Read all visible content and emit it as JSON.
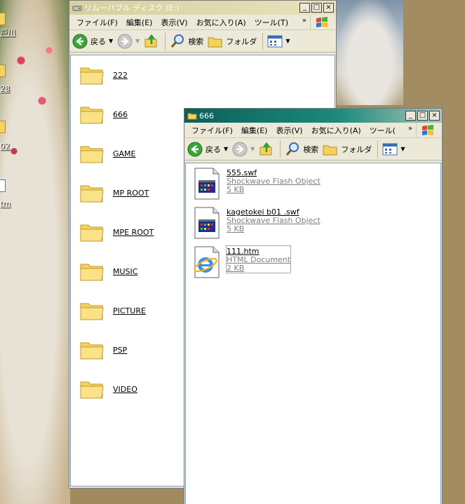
{
  "desktop": {
    "labels": [
      "戸川",
      "28",
      "02",
      "tm"
    ]
  },
  "back_window": {
    "title": "リムーバブル ディスク (E:)",
    "menu": [
      "ファイル(F)",
      "編集(E)",
      "表示(V)",
      "お気に入り(A)",
      "ツール(T)"
    ],
    "menu_more": "»",
    "toolbar": {
      "back": "戻る",
      "search": "検索",
      "folders": "フォルダ"
    },
    "folders": [
      "222",
      "666",
      "GAME",
      "MP ROOT",
      "MPE ROOT",
      "MUSIC",
      "PICTURE",
      "PSP",
      "VIDEO"
    ]
  },
  "front_window": {
    "title": "666",
    "menu": [
      "ファイル(F)",
      "編集(E)",
      "表示(V)",
      "お気に入り(A)",
      "ツール("
    ],
    "menu_more": "»",
    "toolbar": {
      "back": "戻る",
      "search": "検索",
      "folders": "フォルダ"
    },
    "files": [
      {
        "name": "555.swf",
        "type": "Shockwave Flash Object",
        "size": "5 KB",
        "icon": "flash-file-icon"
      },
      {
        "name": "kagetokei b01 .swf",
        "type": "Shockwave Flash Object",
        "size": "5 KB",
        "icon": "flash-file-icon"
      },
      {
        "name": "111.htm",
        "type": "HTML Document",
        "size": "2 KB",
        "icon": "ie-html-icon"
      }
    ]
  },
  "colors": {
    "titlebar_active": "#0a5f5a",
    "titlebar_inactive": "#d7cf9d",
    "folder": "#f3d35c",
    "pane_border": "#7f9db9"
  }
}
